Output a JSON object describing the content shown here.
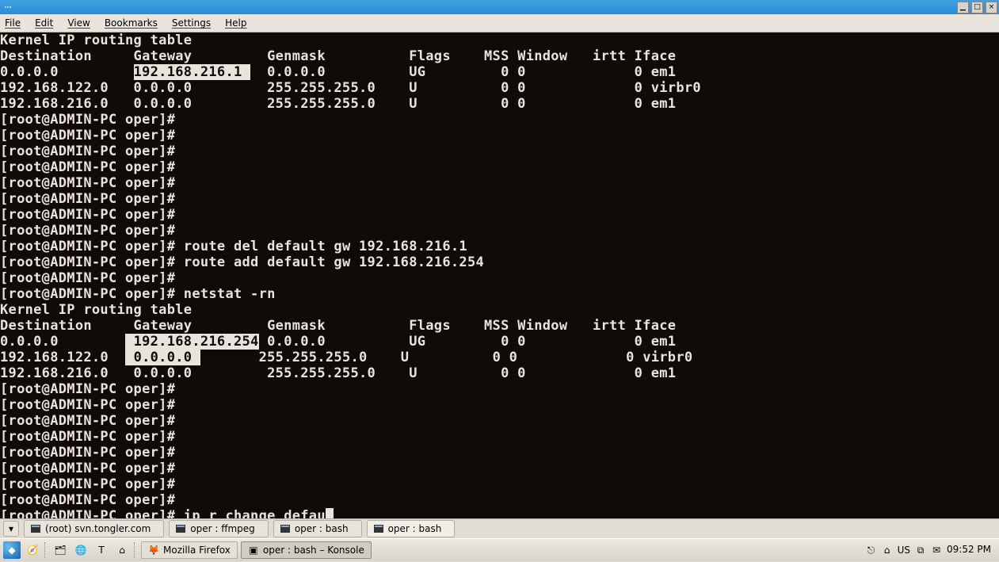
{
  "titlebar": {
    "min": "▁",
    "max": "□",
    "close": "×"
  },
  "menubar": {
    "file": "File",
    "edit": "Edit",
    "view": "View",
    "bookmarks": "Bookmarks",
    "settings": "Settings",
    "help": "Help"
  },
  "terminal": {
    "prompt": "[root@ADMIN-PC oper]#",
    "header": "Kernel IP routing table",
    "cols": "Destination     Gateway         Genmask          Flags    MSS Window   irtt Iface",
    "t1": {
      "r0": "0.0.0.0         ",
      "r0gw": "192.168.216.1 ",
      "r0b": "  0.0.0.0          UG         0 0             0 em1",
      "r1": "192.168.122.0   0.0.0.0         255.255.255.0    U          0 0             0 virbr0",
      "r2": "192.168.216.0   0.0.0.0         255.255.255.0    U          0 0             0 em1"
    },
    "cmd_del": "route del default gw 192.168.216.1",
    "cmd_add": "route add default gw 192.168.216.254",
    "cmd_netstat": "netstat -rn",
    "t2": {
      "r0a": "0.0.0.0        ",
      "r0gw": " 192.168.216.254",
      "r0b": " 0.0.0.0          UG         0 0             0 em1",
      "r1a": "192.168.122.0  ",
      "r1gw": " 0.0.0.0 ",
      "r1b": "       255.255.255.0    U          0 0             0 virbr0",
      "r2": "192.168.216.0   0.0.0.0         255.255.255.0    U          0 0             0 em1"
    },
    "cmd_ip": "ip r change defau"
  },
  "tabs": {
    "t0": "(root) svn.tongler.com",
    "t1": "oper : ffmpeg",
    "t2": "oper : bash",
    "t3": "oper : bash"
  },
  "taskbar": {
    "firefox": "Mozilla Firefox",
    "konsole": "oper : bash – Konsole",
    "us": "US",
    "time": "09:52 PM"
  }
}
